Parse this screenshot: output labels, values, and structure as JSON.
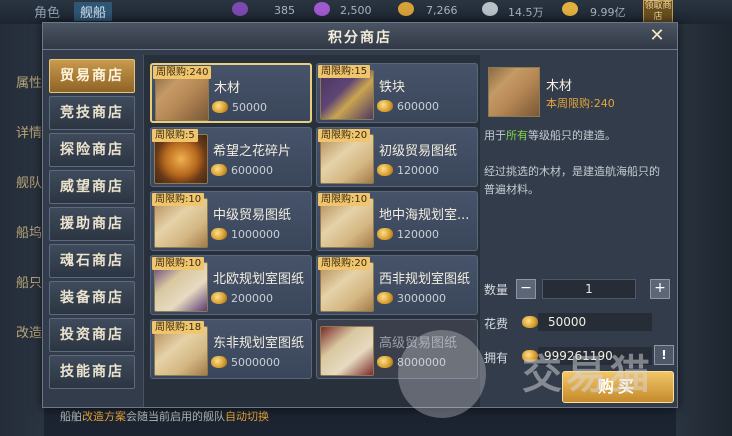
{
  "background": {
    "tabs": [
      "角色",
      "舰船"
    ],
    "resources": [
      {
        "icon": "purple-gem-icon",
        "value": "385"
      },
      {
        "icon": "purple-crystal-icon",
        "value": "2,500"
      },
      {
        "icon": "gold-coin-icon",
        "value": "7,266"
      },
      {
        "icon": "silver-icon",
        "value": "14.5万"
      },
      {
        "icon": "gold-bar-icon",
        "value": "9.99亿"
      }
    ],
    "corner_button": "领取商店",
    "left_items": [
      "属性",
      "详情",
      "舰队",
      "船坞",
      "船只",
      "改造"
    ],
    "bottom_text": {
      "prefix": "船舶",
      "link1": "改造方案",
      "middle": "会随当前启用的舰队",
      "link2": "自动切换"
    }
  },
  "dialog": {
    "title": "积分商店",
    "menu": [
      "贸易商店",
      "竞技商店",
      "探险商店",
      "威望商店",
      "援助商店",
      "魂石商店",
      "装备商店",
      "投资商店",
      "技能商店"
    ],
    "active_menu_index": 0,
    "items": [
      {
        "tag": "周限购:240",
        "name": "木材",
        "price": "50000",
        "thumb": "wood"
      },
      {
        "tag": "周限购:15",
        "name": "铁块",
        "price": "600000",
        "thumb": "iron"
      },
      {
        "tag": "周限购:5",
        "name": "希望之花碎片",
        "price": "600000",
        "thumb": "coin"
      },
      {
        "tag": "周限购:20",
        "name": "初级贸易图纸",
        "price": "120000",
        "thumb": "paper-gold"
      },
      {
        "tag": "周限购:10",
        "name": "中级贸易图纸",
        "price": "1000000",
        "thumb": "paper-gold"
      },
      {
        "tag": "周限购:10",
        "name": "地中海规划室...",
        "price": "120000",
        "thumb": "paper-gold"
      },
      {
        "tag": "周限购:10",
        "name": "北欧规划室图纸",
        "price": "200000",
        "thumb": "paper-purple"
      },
      {
        "tag": "周限购:20",
        "name": "西非规划室图纸",
        "price": "3000000",
        "thumb": "paper-gold"
      },
      {
        "tag": "周限购:18",
        "name": "东非规划室图纸",
        "price": "5000000",
        "thumb": "paper-gold"
      },
      {
        "tag": "",
        "name": "高级贸易图纸",
        "price": "8000000",
        "thumb": "paper-red"
      }
    ],
    "detail": {
      "name": "木材",
      "limit": "本周限购:240",
      "desc1_pre": "用于",
      "desc1_hl": "所有",
      "desc1_post": "等级船只的建造。",
      "desc2": "经过挑选的木材，是建造航海船只的普遍材料。",
      "qty_label": "数量",
      "qty": "1",
      "cost_label": "花费",
      "cost": "50000",
      "own_label": "拥有",
      "own": "999261190",
      "buy_label": "购买",
      "warn_label": "!"
    }
  },
  "watermark": {
    "text": "交易猫"
  }
}
